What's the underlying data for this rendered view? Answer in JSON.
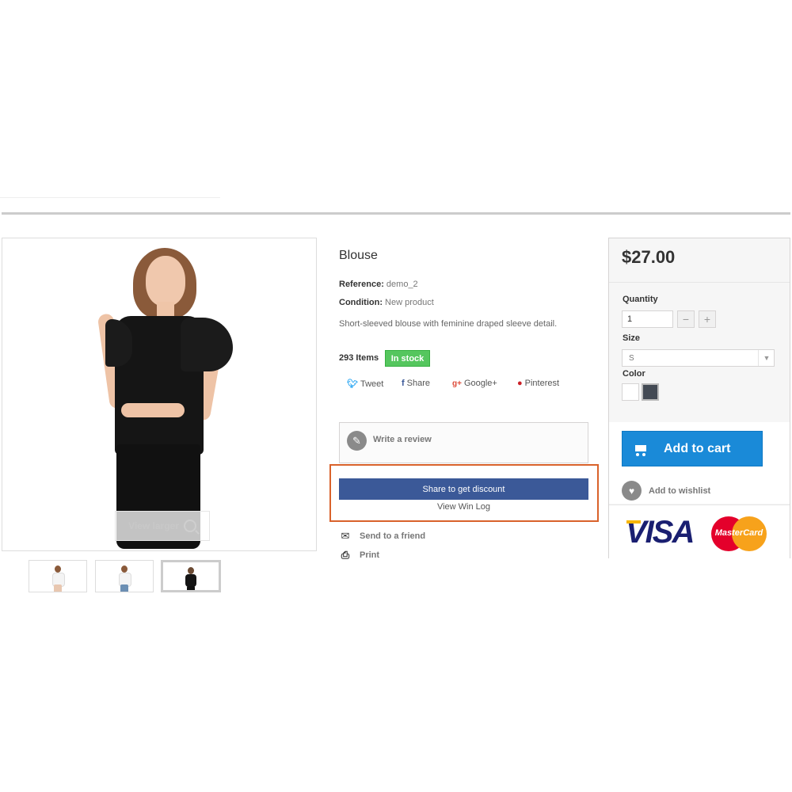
{
  "image_viewer": {
    "view_larger_label": "View larger"
  },
  "product": {
    "title": "Blouse",
    "reference_label": "Reference:",
    "reference_value": "demo_2",
    "condition_label": "Condition:",
    "condition_value": "New product",
    "description": "Short-sleeved blouse with feminine draped sleeve detail.",
    "items_count": "293 Items",
    "stock_badge": "In stock"
  },
  "social": {
    "tweet": "Tweet",
    "share": "Share",
    "google": "Google+",
    "pinterest": "Pinterest"
  },
  "review": {
    "label": "Write a review"
  },
  "discount": {
    "share_button": "Share to get discount",
    "win_log": "View Win Log"
  },
  "utilities": {
    "send_to_friend": "Send to a friend",
    "print": "Print"
  },
  "buy_box": {
    "price": "$27.00",
    "quantity_label": "Quantity",
    "quantity_value": "1",
    "minus": "−",
    "plus": "+",
    "size_label": "Size",
    "size_value": "S",
    "color_label": "Color",
    "add_to_cart": "Add to cart",
    "add_to_wishlist": "Add to wishlist"
  },
  "payment": {
    "visa": "VISA",
    "mastercard": "MasterCard"
  },
  "colors": {
    "stock_green": "#55c65e",
    "share_blue": "#3b5998",
    "cart_blue": "#1a8ad8",
    "highlight_orange": "#d9622b",
    "swatch_white": "#ffffff",
    "swatch_dark": "#434a54"
  },
  "icons": {
    "tweet": "twitter-icon",
    "share": "facebook-icon",
    "google": "google-plus-icon",
    "pinterest": "pinterest-icon",
    "review": "pencil-icon",
    "send": "envelope-icon",
    "print": "printer-icon",
    "cart": "cart-icon",
    "wishlist": "heart-icon",
    "view_larger": "magnifier-icon"
  }
}
